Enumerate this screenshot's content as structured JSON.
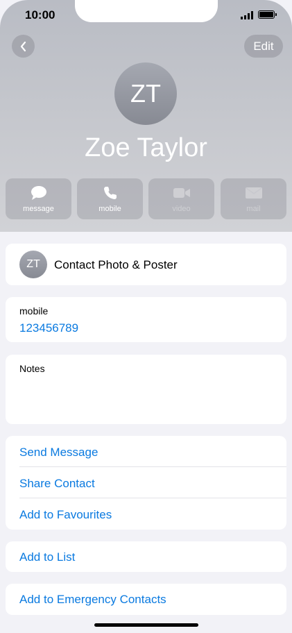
{
  "status_bar": {
    "time": "10:00"
  },
  "nav": {
    "edit_label": "Edit"
  },
  "contact": {
    "initials": "ZT",
    "name": "Zoe Taylor"
  },
  "actions": [
    {
      "icon": "message-icon",
      "label": "message",
      "enabled": true
    },
    {
      "icon": "phone-icon",
      "label": "mobile",
      "enabled": true
    },
    {
      "icon": "video-icon",
      "label": "video",
      "enabled": false
    },
    {
      "icon": "mail-icon",
      "label": "mail",
      "enabled": false
    }
  ],
  "photo_poster": {
    "initials": "ZT",
    "label": "Contact Photo & Poster"
  },
  "phone": {
    "label": "mobile",
    "number": "123456789"
  },
  "notes": {
    "label": "Notes"
  },
  "links_group": [
    "Send Message",
    "Share Contact",
    "Add to Favourites"
  ],
  "add_to_list": "Add to List",
  "emergency": "Add to Emergency Contacts",
  "colors": {
    "link": "#0a7ae0",
    "background": "#f2f2f7"
  }
}
